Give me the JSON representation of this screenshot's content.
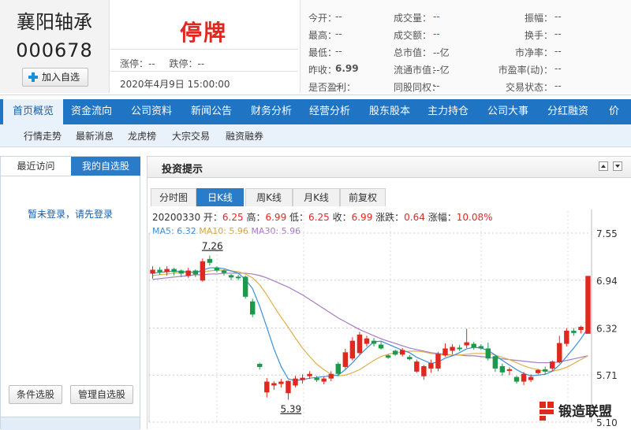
{
  "stock": {
    "name": "襄阳轴承",
    "code": "000678",
    "add_label": "加入自选",
    "status": "停牌",
    "limit_up": "涨停：--",
    "limit_down": "跌停：--",
    "datetime": "2020年4月9日 15:00:00"
  },
  "quote": [
    {
      "label": "今开：",
      "value": "--"
    },
    {
      "label": "成交量：",
      "value": "--"
    },
    {
      "label": "振幅：",
      "value": "--"
    },
    {
      "label": "最高：",
      "value": "--"
    },
    {
      "label": "成交额：",
      "value": "--"
    },
    {
      "label": "换手：",
      "value": "--"
    },
    {
      "label": "最低：",
      "value": "--"
    },
    {
      "label": "总市值：",
      "value": "--亿"
    },
    {
      "label": "市净率：",
      "value": "--"
    },
    {
      "label": "昨收：",
      "value": "6.99"
    },
    {
      "label": "流通市值：",
      "value": "--亿"
    },
    {
      "label": "市盈率(动)：",
      "value": "--"
    },
    {
      "label": "是否盈利：",
      "value": "--"
    },
    {
      "label": "同股同权：",
      "value": "--"
    },
    {
      "label": "交易状态：",
      "value": "--"
    }
  ],
  "nav": [
    "首页概览",
    "资金流向",
    "公司资料",
    "新闻公告",
    "财务分析",
    "经营分析",
    "股东股本",
    "主力持仓",
    "公司大事",
    "分红融资",
    "价值"
  ],
  "subnav": [
    "行情走势",
    "最新消息",
    "龙虎榜",
    "大宗交易",
    "融资融券"
  ],
  "left_panel": {
    "tab_recent": "最近访问",
    "tab_mine": "我的自选股",
    "login_text": "暂未登录，请先登录",
    "btn_condition": "条件选股",
    "btn_manage": "管理自选股"
  },
  "main_panel": {
    "title": "投资提示"
  },
  "chart_tabs": [
    "分时图",
    "日K线",
    "周K线",
    "月K线",
    "前复权"
  ],
  "candle_info": {
    "date": "20200330",
    "open_label": "开：",
    "open": "6.25",
    "high_label": "高：",
    "high": "6.99",
    "low_label": "低：",
    "low": "6.25",
    "close_label": "收：",
    "close": "6.99",
    "chg_label": "涨跌：",
    "chg": "0.64",
    "pct_label": "涨幅：",
    "pct": "10.08%"
  },
  "ma_info": {
    "ma5": "MA5: 6.32",
    "ma10": "MA10: 5.96",
    "ma30": "MA30: 5.96"
  },
  "colors": {
    "up": "#e0281e",
    "down": "#1c9a4c",
    "ma5": "#3a8fd6",
    "ma10": "#e0b04a",
    "ma30": "#a67bc6",
    "nav": "#1f74c4"
  },
  "chart_data": {
    "type": "candlestick",
    "yticks": [
      7.55,
      6.94,
      6.32,
      5.71,
      5.1
    ],
    "ylim": [
      5.1,
      7.55
    ],
    "annotations": [
      {
        "label": "7.26",
        "value": 7.26
      },
      {
        "label": "5.39",
        "value": 5.39
      }
    ],
    "candles": [
      [
        7.03,
        7.07,
        6.96,
        7.12
      ],
      [
        7.07,
        7.05,
        7.01,
        7.11
      ],
      [
        7.05,
        7.08,
        7.0,
        7.12
      ],
      [
        7.08,
        7.05,
        7.0,
        7.1
      ],
      [
        7.06,
        7.03,
        6.98,
        7.08
      ],
      [
        7.0,
        7.06,
        6.97,
        7.1
      ],
      [
        7.06,
        7.02,
        6.98,
        7.08
      ],
      [
        6.94,
        7.18,
        6.92,
        7.22
      ],
      [
        7.21,
        7.17,
        7.13,
        7.26
      ],
      [
        7.1,
        7.07,
        7.04,
        7.12
      ],
      [
        7.06,
        7.04,
        7.0,
        7.08
      ],
      [
        7.0,
        6.98,
        6.94,
        7.02
      ],
      [
        6.98,
        6.97,
        6.94,
        7.01
      ],
      [
        6.98,
        6.73,
        6.7,
        7.0
      ],
      [
        6.66,
        6.5,
        6.46,
        6.7
      ],
      [
        5.85,
        5.82,
        5.78,
        5.87
      ],
      [
        5.49,
        5.62,
        5.42,
        5.67
      ],
      [
        5.58,
        5.6,
        5.52,
        5.63
      ],
      [
        5.6,
        5.62,
        5.55,
        5.66
      ],
      [
        5.48,
        5.63,
        5.39,
        5.64
      ],
      [
        5.58,
        5.66,
        5.55,
        5.7
      ],
      [
        5.65,
        5.67,
        5.6,
        5.72
      ],
      [
        5.7,
        5.72,
        5.66,
        5.76
      ],
      [
        5.67,
        5.65,
        5.62,
        5.7
      ],
      [
        5.63,
        5.66,
        5.59,
        5.69
      ],
      [
        5.67,
        5.72,
        5.63,
        5.76
      ],
      [
        5.85,
        5.73,
        5.7,
        5.88
      ],
      [
        5.82,
        6.0,
        5.79,
        6.05
      ],
      [
        5.93,
        6.15,
        5.9,
        6.2
      ],
      [
        6.0,
        6.23,
        5.97,
        6.27
      ],
      [
        6.12,
        6.18,
        6.08,
        6.22
      ],
      [
        6.15,
        6.12,
        6.08,
        6.19
      ],
      [
        6.1,
        6.06,
        6.04,
        6.14
      ],
      [
        5.96,
        5.94,
        5.92,
        5.98
      ],
      [
        6.02,
        5.98,
        5.96,
        6.04
      ],
      [
        5.98,
        6.03,
        5.95,
        6.06
      ],
      [
        5.94,
        5.92,
        5.9,
        5.97
      ],
      [
        5.76,
        5.88,
        5.74,
        5.91
      ],
      [
        5.7,
        5.82,
        5.65,
        5.84
      ],
      [
        5.8,
        5.86,
        5.74,
        5.91
      ],
      [
        5.8,
        5.98,
        5.76,
        6.01
      ],
      [
        5.97,
        6.05,
        5.95,
        6.12
      ],
      [
        6.03,
        6.07,
        5.98,
        6.11
      ],
      [
        6.06,
        6.05,
        6.02,
        6.1
      ],
      [
        6.1,
        6.13,
        6.06,
        6.31
      ],
      [
        6.11,
        6.07,
        6.04,
        6.14
      ],
      [
        6.08,
        6.06,
        6.04,
        6.11
      ],
      [
        6.05,
        5.93,
        5.9,
        6.13
      ],
      [
        5.95,
        5.8,
        5.75,
        5.97
      ],
      [
        5.82,
        5.75,
        5.7,
        5.86
      ],
      [
        5.78,
        5.78,
        5.71,
        5.81
      ],
      [
        5.68,
        5.63,
        5.6,
        5.7
      ],
      [
        5.63,
        5.72,
        5.58,
        5.75
      ],
      [
        5.65,
        5.68,
        5.62,
        5.72
      ],
      [
        5.74,
        5.77,
        5.72,
        5.79
      ],
      [
        5.78,
        5.76,
        5.72,
        5.82
      ],
      [
        5.8,
        5.88,
        5.76,
        5.9
      ],
      [
        5.88,
        6.12,
        5.86,
        6.22
      ],
      [
        6.12,
        6.28,
        6.08,
        6.32
      ],
      [
        6.28,
        6.26,
        6.22,
        6.32
      ],
      [
        6.3,
        6.33,
        6.25,
        6.35
      ],
      [
        6.25,
        6.99,
        6.25,
        6.99
      ]
    ],
    "ma5": [
      7.03,
      7.04,
      7.05,
      7.06,
      7.05,
      7.05,
      7.04,
      7.07,
      7.1,
      7.1,
      7.09,
      7.06,
      7.03,
      6.95,
      6.83,
      6.6,
      6.33,
      6.05,
      5.82,
      5.66,
      5.64,
      5.65,
      5.67,
      5.68,
      5.69,
      5.7,
      5.71,
      5.78,
      5.87,
      5.97,
      6.06,
      6.14,
      6.15,
      6.11,
      6.07,
      6.03,
      6.0,
      5.94,
      5.9,
      5.86,
      5.88,
      5.93,
      5.96,
      6.0,
      6.05,
      6.07,
      6.06,
      6.03,
      5.97,
      5.9,
      5.84,
      5.78,
      5.73,
      5.7,
      5.71,
      5.72,
      5.76,
      5.84,
      5.95,
      6.06,
      6.18,
      6.32
    ],
    "ma10": [
      7.0,
      7.01,
      7.02,
      7.03,
      7.04,
      7.04,
      7.04,
      7.05,
      7.06,
      7.07,
      7.07,
      7.06,
      7.05,
      7.02,
      6.97,
      6.88,
      6.75,
      6.6,
      6.46,
      6.33,
      6.19,
      6.06,
      5.95,
      5.85,
      5.78,
      5.72,
      5.7,
      5.71,
      5.74,
      5.78,
      5.84,
      5.9,
      5.95,
      5.98,
      6.0,
      6.01,
      6.02,
      6.02,
      6.01,
      5.99,
      5.98,
      5.97,
      5.97,
      5.97,
      5.98,
      5.99,
      5.99,
      5.99,
      5.97,
      5.94,
      5.91,
      5.87,
      5.83,
      5.8,
      5.78,
      5.76,
      5.76,
      5.78,
      5.81,
      5.86,
      5.91,
      5.96
    ],
    "ma30": [
      6.95,
      6.96,
      6.97,
      6.98,
      6.99,
      7.0,
      7.01,
      7.01,
      7.02,
      7.02,
      7.03,
      7.03,
      7.03,
      7.03,
      7.02,
      7.0,
      6.97,
      6.93,
      6.89,
      6.85,
      6.8,
      6.75,
      6.69,
      6.63,
      6.57,
      6.51,
      6.45,
      6.4,
      6.35,
      6.3,
      6.26,
      6.22,
      6.18,
      6.15,
      6.12,
      6.09,
      6.06,
      6.04,
      6.02,
      6.0,
      5.99,
      5.98,
      5.97,
      5.97,
      5.96,
      5.96,
      5.95,
      5.94,
      5.93,
      5.92,
      5.91,
      5.9,
      5.89,
      5.88,
      5.87,
      5.87,
      5.87,
      5.88,
      5.9,
      5.92,
      5.94,
      5.96
    ]
  },
  "watermark": {
    "text": "锻造联盟"
  }
}
